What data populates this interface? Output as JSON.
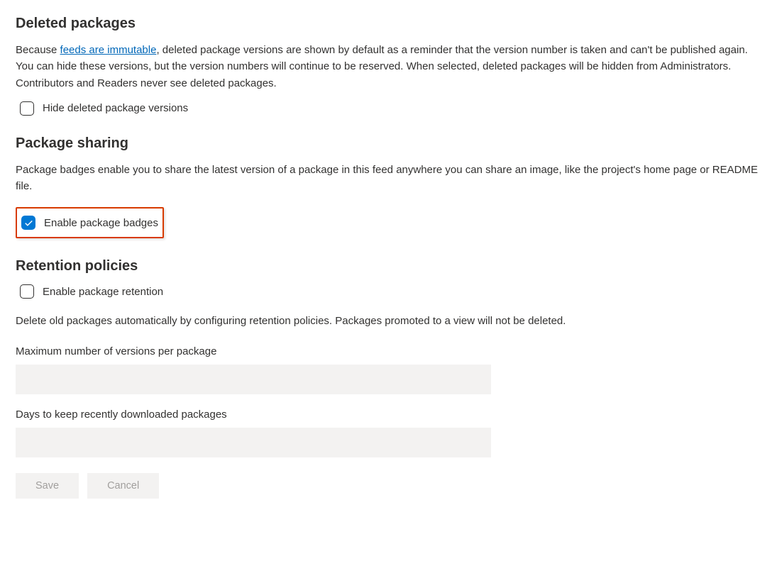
{
  "deleted": {
    "heading": "Deleted packages",
    "desc_before_link": "Because ",
    "link_text": "feeds are immutable",
    "desc_after_link": ", deleted package versions are shown by default as a reminder that the version number is taken and can't be published again. You can hide these versions, but the version numbers will continue to be reserved. When selected, deleted packages will be hidden from Administrators. Contributors and Readers never see deleted packages.",
    "checkbox_label": "Hide deleted package versions"
  },
  "sharing": {
    "heading": "Package sharing",
    "description": "Package badges enable you to share the latest version of a package in this feed anywhere you can share an image, like the project's home page or README file.",
    "checkbox_label": "Enable package badges"
  },
  "retention": {
    "heading": "Retention policies",
    "checkbox_label": "Enable package retention",
    "description": "Delete old packages automatically by configuring retention policies. Packages promoted to a view will not be deleted.",
    "max_versions_label": "Maximum number of versions per package",
    "max_versions_value": "",
    "days_keep_label": "Days to keep recently downloaded packages",
    "days_keep_value": ""
  },
  "buttons": {
    "save": "Save",
    "cancel": "Cancel"
  }
}
